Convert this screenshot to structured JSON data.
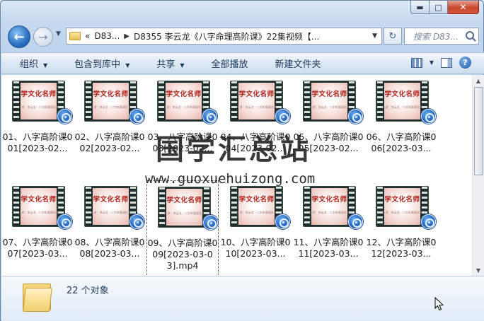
{
  "window": {
    "caption": {
      "minimize": "▬",
      "maximize": "□",
      "close": "✕"
    }
  },
  "address": {
    "overflow": "«",
    "crumbs": [
      "D83...",
      "D8355 李云龙《八字命理高阶课》22集视频【..."
    ],
    "refresh_icon": "refresh-icon",
    "search_placeholder": "搜索 D83..."
  },
  "toolbar": {
    "organize": "组织",
    "include_in_library": "包含到库中",
    "share": "共享",
    "play_all": "全部播放",
    "new_folder": "新建文件夹"
  },
  "thumbnail": {
    "frame_title": "学文化名师",
    "frame_sub": "主讲：李云龙 · 八字命理高阶课"
  },
  "files": [
    {
      "name": "01、八字高阶课001[2023-02..."
    },
    {
      "name": "02、八字高阶课002[2023-02..."
    },
    {
      "name": "03、八字高阶课003[2023-02..."
    },
    {
      "name": "04、八字高阶课004[2023-02..."
    },
    {
      "name": "05、八字高阶课005[2023-02..."
    },
    {
      "name": "06、八字高阶课006[2023-03..."
    },
    {
      "name": "07、八字高阶课007[2023-03..."
    },
    {
      "name": "08、八字高阶课008[2023-03..."
    },
    {
      "name": "09、八字高阶课009[2023-03-03].mp4"
    },
    {
      "name": "10、八字高阶课010[2023-03..."
    },
    {
      "name": "11、八字高阶课011[2023-03..."
    },
    {
      "name": "12、八字高阶课012[2023-03..."
    }
  ],
  "selected_index": 8,
  "watermark": {
    "text": "国学汇总站",
    "url": "www.guoxuehuizong.com"
  },
  "details": {
    "count": "22 个对象"
  },
  "colors": {
    "toolbar_text": "#1e395b",
    "badge_blue": "#1657b3",
    "thumb_title": "#b0231c"
  }
}
